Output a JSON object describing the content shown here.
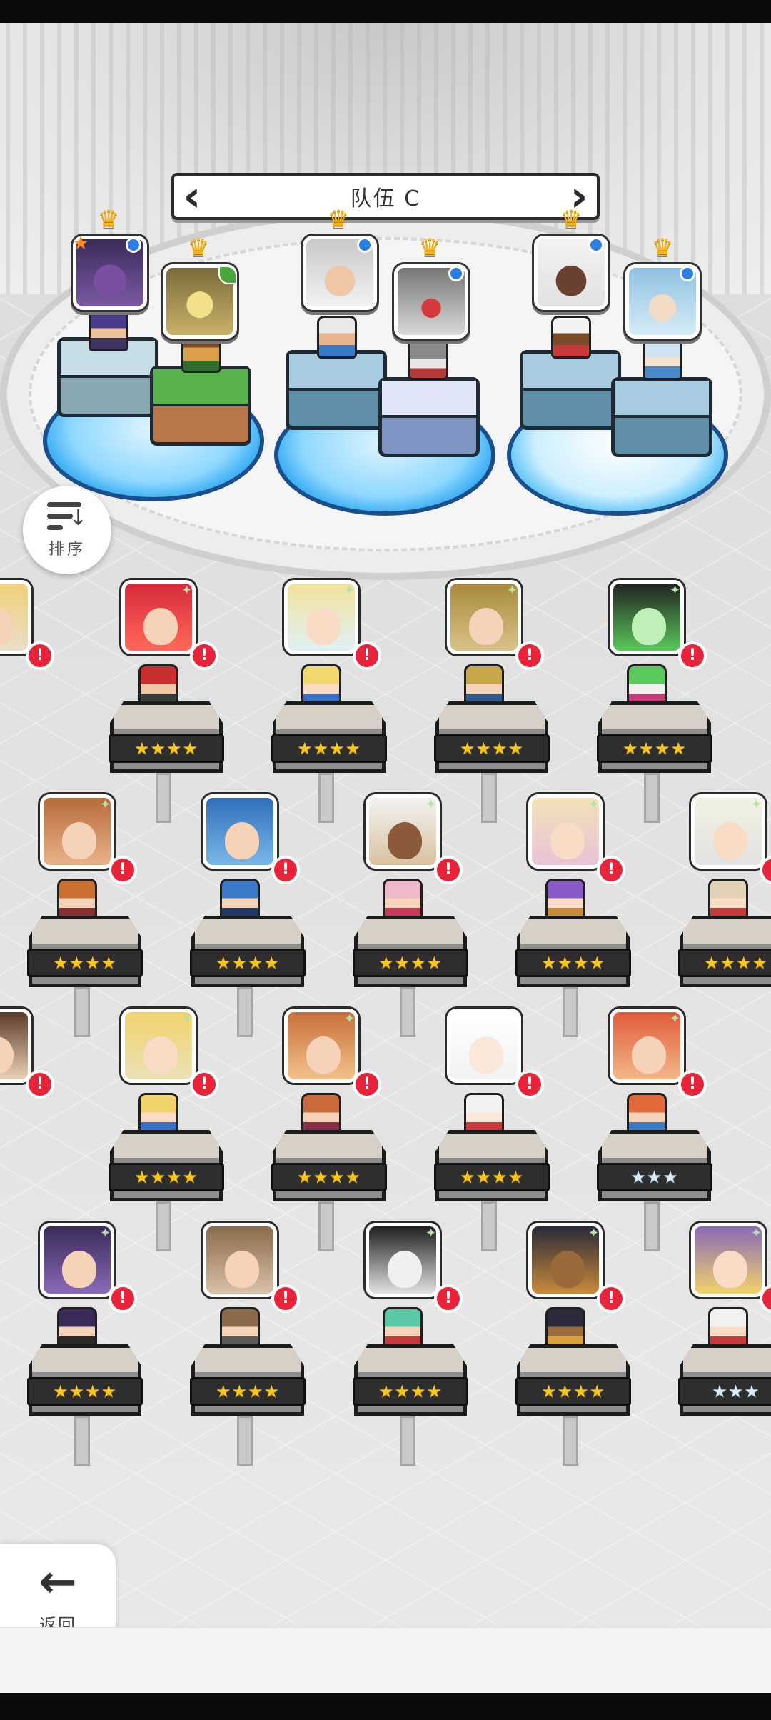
{
  "team": {
    "title": "队伍 C"
  },
  "controls": {
    "sort_label": "排序",
    "back_label": "返回"
  },
  "colors": {
    "crown": "#f3b51b",
    "alert": "#e8243b",
    "pool": "#1fa0ef",
    "stars_gold": "#f7c51c",
    "stars_silver": "#d8ecf7"
  },
  "icons": {
    "sort": "sort-descending-icon",
    "back": "arrow-left-icon",
    "alert": "exclamation-icon",
    "crown": "crown-icon",
    "prev_team": "chevron-left-icon",
    "next_team": "chevron-right-icon"
  },
  "roster": {
    "rows": [
      {
        "heroes": [
          {
            "stars": "★★★★",
            "silver": false
          },
          {
            "stars": "★★★★",
            "silver": false
          },
          {
            "stars": "★★★★",
            "silver": false
          },
          {
            "stars": "★★★★",
            "silver": false
          }
        ]
      },
      {
        "heroes": [
          {
            "stars": "★★★★",
            "silver": false
          },
          {
            "stars": "★★★★",
            "silver": false
          },
          {
            "stars": "★★★★",
            "silver": false
          },
          {
            "stars": "★★★★",
            "silver": false
          },
          {
            "stars": "★★★★",
            "silver": false
          }
        ]
      },
      {
        "heroes": [
          {
            "stars": "★★★★",
            "silver": false
          },
          {
            "stars": "★★★★",
            "silver": false
          },
          {
            "stars": "★★★★",
            "silver": false
          },
          {
            "stars": "★★★",
            "silver": true
          }
        ]
      },
      {
        "heroes": [
          {
            "stars": "★★★★",
            "silver": false
          },
          {
            "stars": "★★★★",
            "silver": false
          },
          {
            "stars": "★★★★",
            "silver": false
          },
          {
            "stars": "★★★★",
            "silver": false
          },
          {
            "stars": "★★★",
            "silver": true
          }
        ]
      }
    ]
  }
}
